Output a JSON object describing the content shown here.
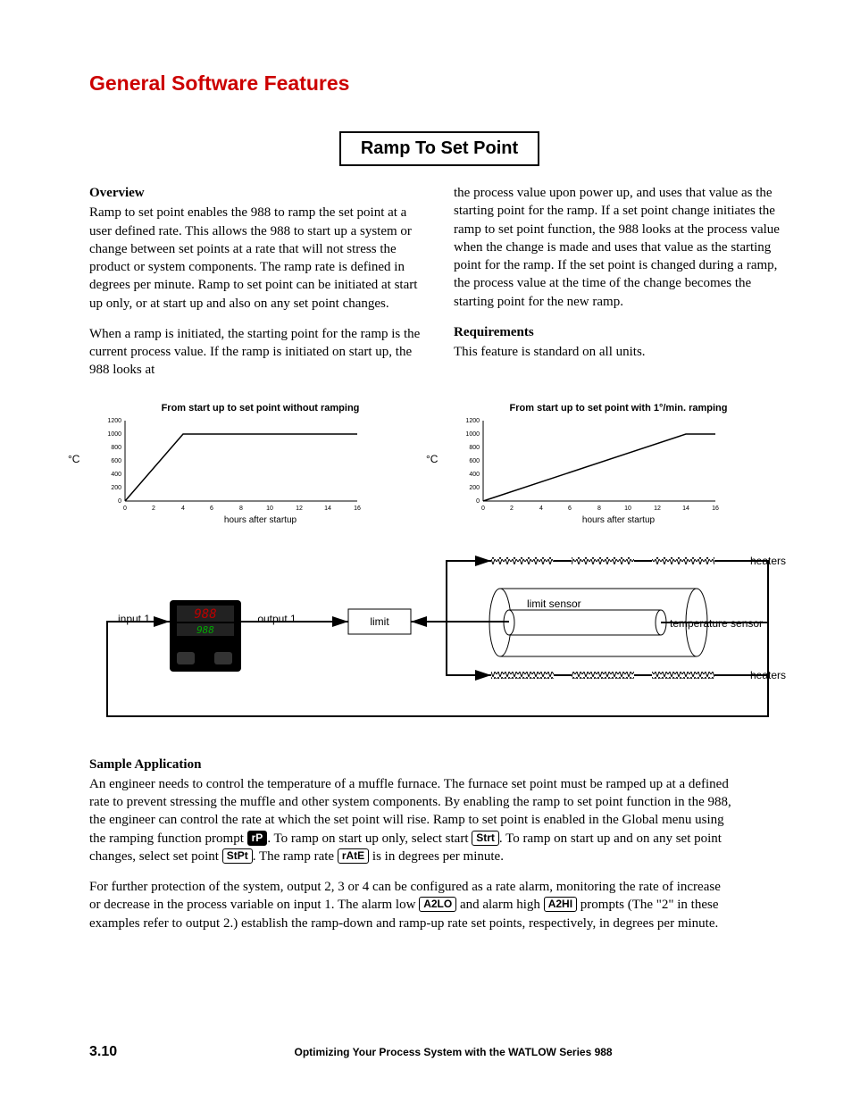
{
  "header": {
    "title": "General Software Features"
  },
  "box_title": "Ramp To Set Point",
  "overview": {
    "heading": "Overview",
    "p1": "Ramp to set point enables the 988 to ramp the set point at a user defined rate. This allows the 988 to start up a system or change between set points at a rate that will not stress the product or system components. The ramp rate is defined in degrees per minute. Ramp to set point can be initiated at start up only, or at start up and also on any set point changes.",
    "p2": "When a ramp is initiated, the starting point for the ramp is the current process value. If the ramp is initiated on start up, the 988 looks at",
    "p3": "the process value upon power up, and uses that value as the starting point for the ramp. If a set point change initiates the ramp to set point function, the 988 looks at the process value when the change is made and uses that value as the starting point for the ramp. If the set point is changed during a ramp, the process value at the time of the change becomes the starting point for the new ramp."
  },
  "requirements": {
    "heading": "Requirements",
    "p1": "This feature is standard on all units."
  },
  "chart_data": [
    {
      "type": "line",
      "title": "From start up to set point without ramping",
      "xlabel": "hours after startup",
      "ylabel": "°C",
      "ylim": [
        0,
        1200
      ],
      "xlim": [
        0,
        16
      ],
      "xticks": [
        0,
        2,
        4,
        6,
        8,
        10,
        12,
        14,
        16
      ],
      "yticks": [
        0,
        200,
        400,
        600,
        800,
        1000,
        1200
      ],
      "series": [
        {
          "name": "temp",
          "x": [
            0,
            4,
            16
          ],
          "y": [
            0,
            1000,
            1000
          ]
        }
      ]
    },
    {
      "type": "line",
      "title": "From start up to set point with 1°/min. ramping",
      "xlabel": "hours after startup",
      "ylabel": "°C",
      "ylim": [
        0,
        1200
      ],
      "xlim": [
        0,
        16
      ],
      "xticks": [
        0,
        2,
        4,
        6,
        8,
        10,
        12,
        14,
        16
      ],
      "yticks": [
        0,
        200,
        400,
        600,
        800,
        1000,
        1200
      ],
      "series": [
        {
          "name": "temp",
          "x": [
            0,
            14,
            16
          ],
          "y": [
            0,
            1000,
            1000
          ]
        }
      ]
    }
  ],
  "diagram": {
    "input": "input 1",
    "output": "output 1",
    "controller_top": "988",
    "controller_bottom": "988",
    "limit": "limit",
    "limit_sensor": "limit sensor",
    "temp_sensor": "temperature sensor",
    "heaters": "heaters"
  },
  "sample": {
    "heading": "Sample Application",
    "p1a": "An engineer needs to control the temperature of a muffle furnace. The furnace set point must be ramped up at a defined rate to prevent stressing the muffle and other system components. By enabling the ramp to set point function in the 988, the engineer can control the rate at which the set point will rise. Ramp to set point is enabled in the Global menu using the ramping function prompt ",
    "prompt_rp": "rP",
    "p1b": ". To ramp on start up only, select start ",
    "prompt_strt": "Strt",
    "p1c": ". To ramp on start up and on any set point changes, select set point ",
    "prompt_stpt": "StPt",
    "p1d": ". The ramp rate ",
    "prompt_rate": "rAtE",
    "p1e": " is in degrees per minute.",
    "p2a": "For further protection of the system, output 2, 3 or 4 can be configured as a rate alarm, monitoring the rate of increase or decrease in the process variable on input 1. The alarm low ",
    "prompt_a2lo": "A2LO",
    "p2b": " and alarm high ",
    "prompt_a2hi": "A2HI",
    "p2c": " prompts (The \"2\" in these examples refer to output 2.) establish the ramp-down and ramp-up rate set points, respectively, in degrees per minute."
  },
  "footer": {
    "page": "3.10",
    "text": "Optimizing Your Process System with the WATLOW Series 988"
  }
}
